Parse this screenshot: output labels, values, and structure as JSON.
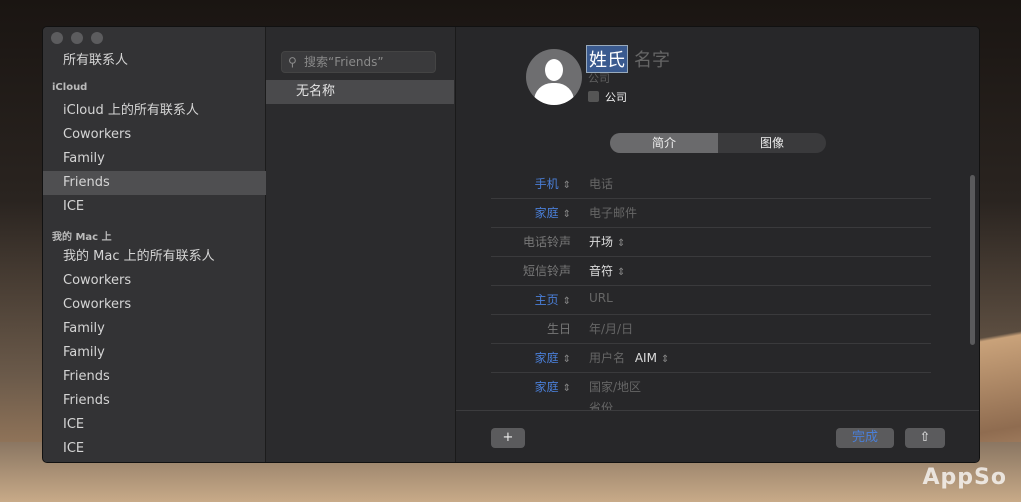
{
  "sidebar": {
    "all": "所有联系人",
    "icloud_header": "iCloud",
    "icloud_items": [
      "iCloud 上的所有联系人",
      "Coworkers",
      "Family",
      "Friends",
      "ICE"
    ],
    "mac_header": "我的 Mac 上",
    "mac_items": [
      "我的 Mac 上的所有联系人",
      "Coworkers",
      "Coworkers",
      "Family",
      "Family",
      "Friends",
      "Friends",
      "ICE",
      "ICE"
    ]
  },
  "list": {
    "search_placeholder": "搜索“Friends”",
    "items": [
      "无名称"
    ]
  },
  "card": {
    "last_name": "姓氏",
    "first_name": "名字",
    "company_placeholder": "公司",
    "company_checkbox": "公司",
    "tabs": [
      "简介",
      "图像"
    ],
    "fields": [
      {
        "label": "手机",
        "value": "电话",
        "blue": true
      },
      {
        "label": "家庭",
        "value": "电子邮件",
        "blue": true
      },
      {
        "label": "电话铃声",
        "value": "开场",
        "blue": false,
        "popup": true
      },
      {
        "label": "短信铃声",
        "value": "音符",
        "blue": false,
        "popup": true
      },
      {
        "label": "主页",
        "value": "URL",
        "blue": true
      },
      {
        "label": "生日",
        "value": "年/月/日",
        "blue": false
      },
      {
        "label": "家庭",
        "value": "用户名",
        "extra": "AIM",
        "blue": true
      },
      {
        "label": "家庭",
        "value": "国家/地区",
        "value2": "省份",
        "blue": true
      }
    ]
  },
  "footer": {
    "add": "+",
    "done": "完成",
    "share": "⇧"
  },
  "watermark": "AppSo"
}
